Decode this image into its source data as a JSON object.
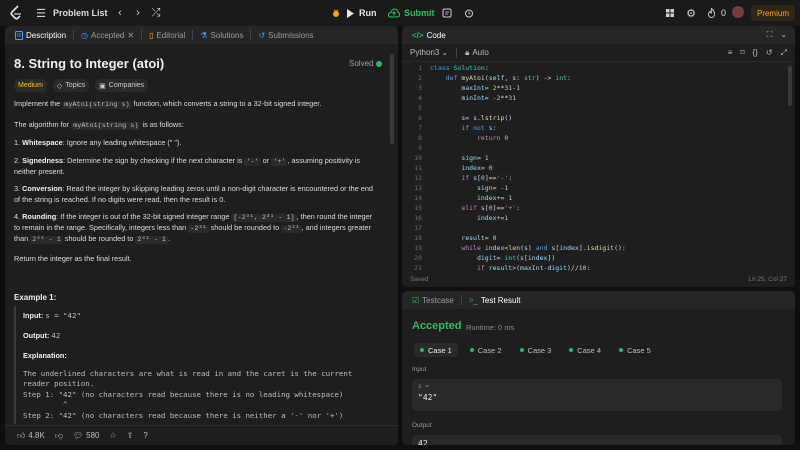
{
  "nav": {
    "problem_list": "Problem List",
    "run": "Run",
    "submit": "Submit",
    "fire_count": "0",
    "premium": "Premium"
  },
  "left": {
    "tabs": {
      "description": "Description",
      "accepted": "Accepted",
      "editorial": "Editorial",
      "solutions": "Solutions",
      "submissions": "Submissions"
    },
    "title": "8. String to Integer (atoi)",
    "solved": "Solved",
    "tags": {
      "difficulty": "Medium",
      "topics": "Topics",
      "companies": "Companies"
    },
    "intro_pre": "Implement the ",
    "intro_code": "myAtoi(string s)",
    "intro_post": " function, which converts a string to a 32-bit signed integer.",
    "algo_pre": "The algorithm for ",
    "algo_code": "myAtoi(string s)",
    "algo_post": " is as follows:",
    "steps": [
      {
        "num": "1.",
        "label": "Whitespace",
        "text": ": Ignore any leading whitespace (\" \")."
      },
      {
        "num": "2.",
        "label": "Signedness",
        "text_a": ": Determine the sign by checking if the next character is ",
        "code_a": "'-'",
        "text_b": " or ",
        "code_b": "'+'",
        "text_c": ", assuming positivity is neither present."
      },
      {
        "num": "3.",
        "label": "Conversion",
        "text": ": Read the integer by skipping leading zeros until a non-digit character is encountered or the end of the string is reached. If no digits were read, then the result is 0."
      },
      {
        "num": "4.",
        "label": "Rounding",
        "text_a": ": If the integer is out of the 32-bit signed integer range ",
        "code_a": "[-2³¹, 2³¹ - 1]",
        "text_b": ", then round the integer to remain in the range. Specifically, integers less than ",
        "code_b": "-2³¹",
        "text_c": " should be rounded to ",
        "code_c": "-2³¹",
        "text_d": ", and integers greater than ",
        "code_d": "2³¹ - 1",
        "text_e": " should be rounded to ",
        "code_e": "2³¹ - 1",
        "text_f": "."
      }
    ],
    "return_text": "Return the integer as the final result.",
    "example_title": "Example 1:",
    "input_label": "Input:",
    "input_value": "s = \"42\"",
    "output_label": "Output:",
    "output_value": "42",
    "explanation_label": "Explanation:",
    "explanation_lines": [
      "The underlined characters are what is read in and the caret is the current reader position.",
      "Step 1: \"42\" (no characters read because there is no leading whitespace)",
      "         ^",
      "Step 2: \"42\" (no characters read because there is neither a '-' nor '+')"
    ],
    "footer": {
      "likes": "4.8K",
      "comments": "580"
    }
  },
  "code": {
    "tab": "Code",
    "language": "Python3",
    "mode": "Auto",
    "status_left": "Saved",
    "status_right": "Ln 25, Col 27",
    "line_numbers": [
      "1",
      "2",
      "3",
      "4",
      "5",
      "6",
      "7",
      "8",
      "9",
      "10",
      "11",
      "12",
      "13",
      "14",
      "15",
      "16",
      "17",
      "18",
      "19",
      "20",
      "21"
    ]
  },
  "result": {
    "tabs": {
      "testcase": "Testcase",
      "test_result": "Test Result"
    },
    "status": "Accepted",
    "runtime": "Runtime: 0 ms",
    "cases": [
      "Case 1",
      "Case 2",
      "Case 3",
      "Case 4",
      "Case 5"
    ],
    "input_label": "Input",
    "input_var": "s =",
    "input_value": "\"42\"",
    "output_label": "Output",
    "output_value": "42"
  },
  "colors": {
    "accent": "#2cbb5d",
    "premium": "#ffa116",
    "medium": "#ffc01e",
    "bg": "#0f0f0f",
    "panel": "#1e1e1e"
  }
}
